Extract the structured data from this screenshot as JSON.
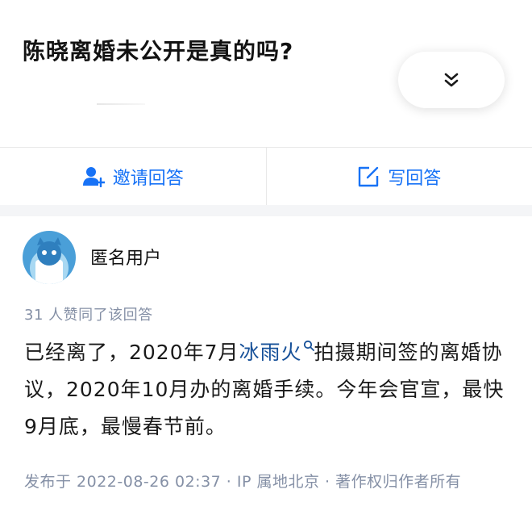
{
  "question": {
    "title": "陈晓离婚未公开是真的吗?",
    "expand_icon": "double-chevron-down-icon"
  },
  "actions": {
    "invite_label": "邀请回答",
    "invite_icon": "invite-user-icon",
    "write_label": "写回答",
    "write_icon": "edit-icon"
  },
  "answer": {
    "author": "匿名用户",
    "votes_text": "31 人赞同了该回答",
    "content_part1": "已经离了，2020年7月",
    "content_link": "冰雨火",
    "content_part2": "拍摄期间签的离婚协议，2020年10月办的离婚手续。今年会官宣，最快9月底，最慢春节前。",
    "meta_line": "发布于 2022-08-26 02:37 · IP 属地北京 · 著作权归作者所有"
  },
  "colors": {
    "accent": "#1772f6",
    "link": "#175199",
    "meta": "#8590a6",
    "avatar_bg": "#4a9fd8"
  }
}
